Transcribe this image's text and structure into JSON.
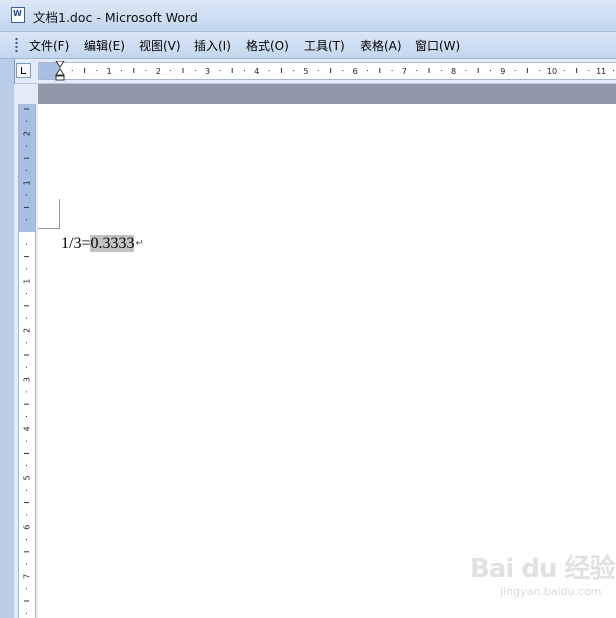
{
  "window": {
    "title": "文档1.doc - Microsoft Word",
    "icon": "word-document-icon"
  },
  "menubar": {
    "items": [
      {
        "label": "文件(F)"
      },
      {
        "label": "编辑(E)"
      },
      {
        "label": "视图(V)"
      },
      {
        "label": "插入(I)"
      },
      {
        "label": "格式(O)"
      },
      {
        "label": "工具(T)"
      },
      {
        "label": "表格(A)"
      },
      {
        "label": "窗口(W)"
      }
    ]
  },
  "horizontal_ruler": {
    "numbers": [
      "1",
      "2",
      "3",
      "4",
      "5",
      "6",
      "7",
      "8",
      "9",
      "10",
      "11"
    ]
  },
  "vertical_ruler": {
    "numbers": [
      "2",
      "1",
      "1",
      "2",
      "3",
      "4",
      "5",
      "6",
      "7"
    ]
  },
  "document": {
    "text_plain": "1/3=",
    "text_selected": "0.3333",
    "paragraph_mark": "↵"
  },
  "watermark": {
    "brand": "Bai du 经验",
    "url": "jingyan.baidu.com"
  },
  "colors": {
    "titlebar": "#cfdff2",
    "selection": "#c3c3c3",
    "ruler_margin": "#a9bee3"
  }
}
